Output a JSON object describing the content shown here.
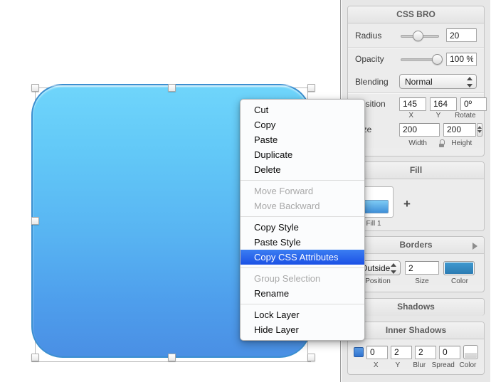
{
  "app": {
    "canvas_background": "#ffffff",
    "panel_background": "#e7e7e7"
  },
  "shape": {
    "name": "rounded-rectangle",
    "fill_gradient_top": "#6fd5fb",
    "fill_gradient_bottom": "#4a8fe4",
    "border_color": "#3b8fd0",
    "corner_radius": 44
  },
  "inspector": {
    "title": "CSS BRO",
    "radius": {
      "label": "Radius",
      "value": "20",
      "slider_percent": 45
    },
    "opacity": {
      "label": "Opacity",
      "value": "100 %",
      "slider_percent": 92
    },
    "blending": {
      "label": "Blending",
      "value": "Normal"
    },
    "position": {
      "label": "Position",
      "x": "145",
      "y": "164",
      "rotate": "0º",
      "x_caption": "X",
      "y_caption": "Y",
      "rotate_caption": "Rotate"
    },
    "size": {
      "label": "Size",
      "width": "200",
      "height": "200",
      "width_caption": "Width",
      "height_caption": "Height",
      "lock_icon": "lock-open-icon"
    },
    "fill": {
      "title": "Fill",
      "swatch_label": "Fill 1",
      "add_label": "+",
      "checkbox_checked": true,
      "swatch_color": "#58aced"
    },
    "borders": {
      "title": "Borders",
      "disclosure_icon": "chevron-right-icon",
      "position_value": "Outside",
      "size_value": "2",
      "color_value": "#3f9ad1",
      "position_caption": "Position",
      "size_caption": "Size",
      "color_caption": "Color"
    },
    "shadows": {
      "title": "Shadows"
    },
    "inner_shadows": {
      "title": "Inner Shadows",
      "add_icon": "plus-icon",
      "checkbox_checked": true,
      "x": "0",
      "y": "2",
      "blur": "2",
      "spread": "0",
      "x_caption": "X",
      "y_caption": "Y",
      "blur_caption": "Blur",
      "spread_caption": "Spread",
      "color_caption": "Color"
    }
  },
  "context_menu": {
    "highlight_color": "#1b51e5",
    "groups": [
      {
        "items": [
          {
            "label": "Cut",
            "disabled": false,
            "selected": false
          },
          {
            "label": "Copy",
            "disabled": false,
            "selected": false
          },
          {
            "label": "Paste",
            "disabled": false,
            "selected": false
          },
          {
            "label": "Duplicate",
            "disabled": false,
            "selected": false
          },
          {
            "label": "Delete",
            "disabled": false,
            "selected": false
          }
        ]
      },
      {
        "items": [
          {
            "label": "Move Forward",
            "disabled": true,
            "selected": false
          },
          {
            "label": "Move Backward",
            "disabled": true,
            "selected": false
          }
        ]
      },
      {
        "items": [
          {
            "label": "Copy Style",
            "disabled": false,
            "selected": false
          },
          {
            "label": "Paste Style",
            "disabled": false,
            "selected": false
          },
          {
            "label": "Copy CSS Attributes",
            "disabled": false,
            "selected": true
          }
        ]
      },
      {
        "items": [
          {
            "label": "Group Selection",
            "disabled": true,
            "selected": false
          },
          {
            "label": "Rename",
            "disabled": false,
            "selected": false
          }
        ]
      },
      {
        "items": [
          {
            "label": "Lock Layer",
            "disabled": false,
            "selected": false
          },
          {
            "label": "Hide Layer",
            "disabled": false,
            "selected": false
          }
        ]
      }
    ]
  }
}
